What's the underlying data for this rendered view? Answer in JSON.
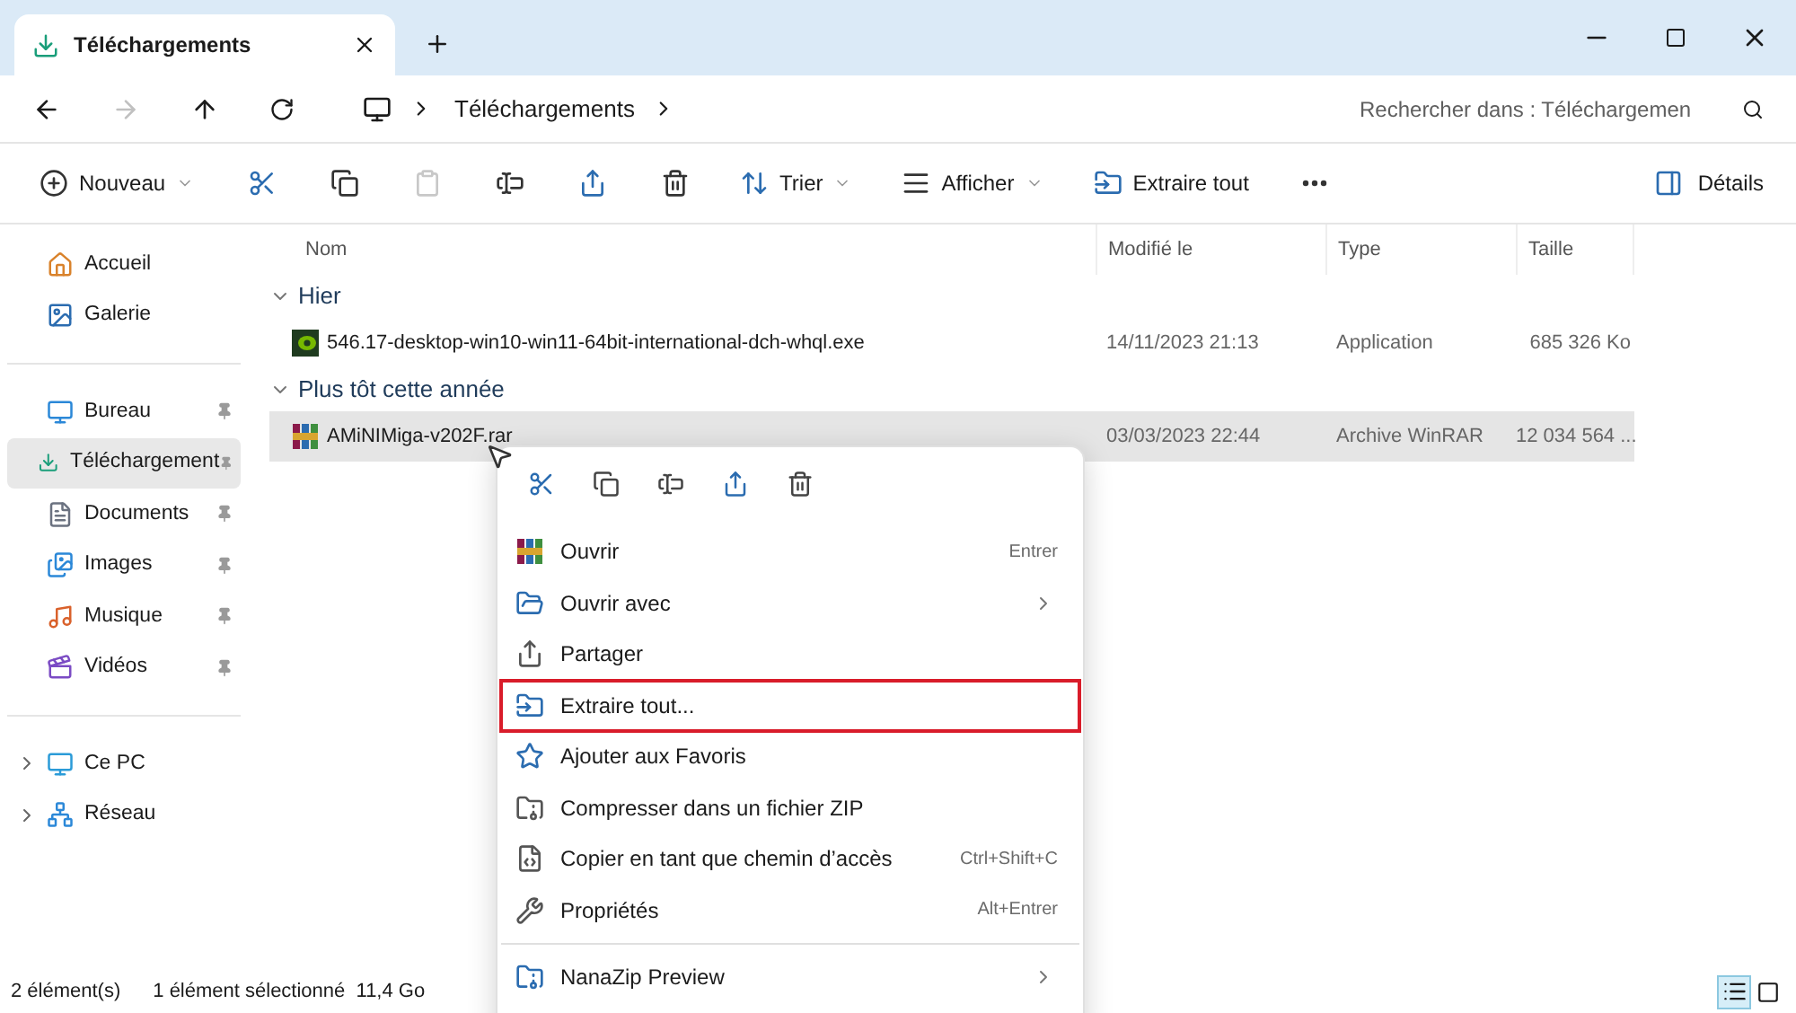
{
  "tab": {
    "title": "Téléchargements"
  },
  "address": {
    "crumbs": [
      "Téléchargements"
    ],
    "search_placeholder": "Rechercher dans : Téléchargemen"
  },
  "toolbar": {
    "items": [
      {
        "kind": "new",
        "label": "Nouveau",
        "dropdown": true,
        "disabled": false
      },
      {
        "kind": "cut",
        "disabled": false
      },
      {
        "kind": "copy",
        "disabled": false
      },
      {
        "kind": "paste",
        "disabled": true
      },
      {
        "kind": "rename",
        "disabled": false
      },
      {
        "kind": "share",
        "disabled": false
      },
      {
        "kind": "delete",
        "disabled": false
      },
      {
        "kind": "sort",
        "label": "Trier",
        "dropdown": true,
        "disabled": false
      },
      {
        "kind": "view",
        "label": "Afficher",
        "dropdown": true,
        "disabled": false
      },
      {
        "kind": "extract",
        "label": "Extraire tout",
        "disabled": false
      },
      {
        "kind": "more",
        "disabled": false
      }
    ],
    "details": "Détails"
  },
  "sidebar": {
    "sections": [
      [
        {
          "kind": "home",
          "label": "Accueil",
          "pinned": false,
          "selected": false
        },
        {
          "kind": "gallery",
          "label": "Galerie",
          "pinned": false,
          "selected": false
        }
      ],
      [
        {
          "kind": "desktop",
          "label": "Bureau",
          "pinned": true,
          "selected": false
        },
        {
          "kind": "download",
          "label": "Téléchargement",
          "pinned": true,
          "selected": true
        },
        {
          "kind": "documents",
          "label": "Documents",
          "pinned": true,
          "selected": false
        },
        {
          "kind": "pictures",
          "label": "Images",
          "pinned": true,
          "selected": false
        },
        {
          "kind": "music",
          "label": "Musique",
          "pinned": true,
          "selected": false
        },
        {
          "kind": "videos",
          "label": "Vidéos",
          "pinned": true,
          "selected": false
        }
      ],
      [
        {
          "kind": "pc",
          "label": "Ce PC",
          "pinned": false,
          "selected": false,
          "expandable": true
        },
        {
          "kind": "network",
          "label": "Réseau",
          "pinned": false,
          "selected": false,
          "expandable": true
        }
      ]
    ]
  },
  "table": {
    "columns": [
      "Nom",
      "Modifié le",
      "Type",
      "Taille"
    ],
    "groups": [
      {
        "title": "Hier",
        "expanded": true,
        "rows": [
          {
            "kind": "exe",
            "name": "546.17-desktop-win10-win11-64bit-international-dch-whql.exe",
            "modified": "14/11/2023 21:13",
            "type": "Application",
            "size": "685 326 Ko",
            "selected": false
          }
        ]
      },
      {
        "title": "Plus tôt cette année",
        "expanded": true,
        "rows": [
          {
            "kind": "rar",
            "name": "AMiNIMiga-v202F.rar",
            "modified": "03/03/2023 22:44",
            "type": "Archive WinRAR",
            "size": "12 034 564 ...",
            "selected": true
          }
        ]
      }
    ]
  },
  "context_menu": {
    "quick_actions": [
      {
        "kind": "cut"
      },
      {
        "kind": "copy"
      },
      {
        "kind": "rename"
      },
      {
        "kind": "share"
      },
      {
        "kind": "delete"
      }
    ],
    "items": [
      {
        "kind": "rar",
        "label": "Ouvrir",
        "shortcut": "Entrer",
        "submenu": false,
        "highlighted": false
      },
      {
        "kind": "openwith",
        "label": "Ouvrir avec",
        "submenu": true,
        "highlighted": false
      },
      {
        "kind": "share",
        "label": "Partager",
        "submenu": false,
        "highlighted": false
      },
      {
        "kind": "extract",
        "label": "Extraire tout...",
        "submenu": false,
        "highlighted": true
      },
      {
        "kind": "star",
        "label": "Ajouter aux Favoris",
        "submenu": false,
        "highlighted": false
      },
      {
        "kind": "zip",
        "label": "Compresser dans un fichier ZIP",
        "submenu": false,
        "highlighted": false
      },
      {
        "kind": "path",
        "label": "Copier en tant que chemin d’accès",
        "shortcut": "Ctrl+Shift+C",
        "submenu": false,
        "highlighted": false
      },
      {
        "kind": "wrench",
        "label": "Propriétés",
        "shortcut": "Alt+Entrer",
        "submenu": false,
        "highlighted": false
      },
      {
        "kind": "nanazip",
        "label": "NanaZip Preview",
        "submenu": true,
        "highlighted": false,
        "separated": true
      }
    ]
  },
  "status_bar": {
    "count": "2 élément(s)",
    "selection": "1 élément sélectionné  11,4 Go",
    "views": [
      {
        "kind": "details",
        "selected": true
      },
      {
        "kind": "tiles",
        "selected": false
      }
    ]
  }
}
